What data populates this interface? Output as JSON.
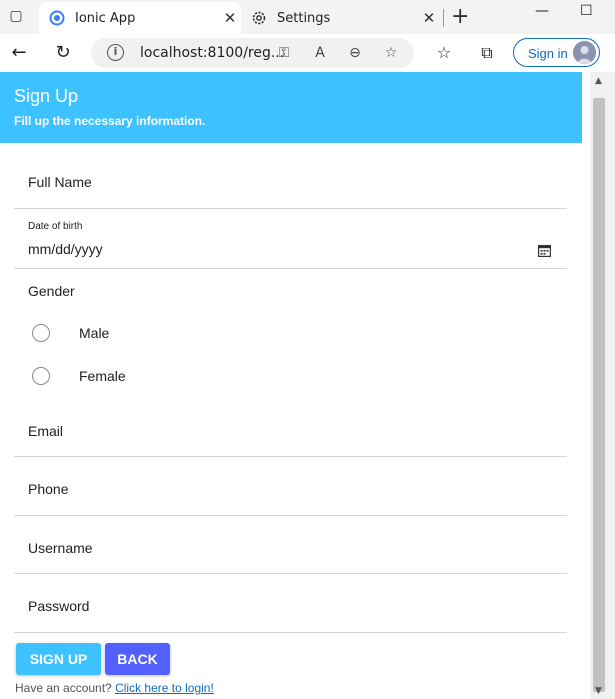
{
  "browser": {
    "tabs": [
      {
        "title": "Ionic App",
        "icon": "ionic-icon",
        "active": true
      },
      {
        "title": "Settings",
        "icon": "gear-icon",
        "active": false
      }
    ],
    "url": "localhost:8100/reg...",
    "signin_label": "Sign in",
    "accent_color": "#0f6cbd"
  },
  "page": {
    "header": {
      "title": "Sign Up",
      "subtitle": "Fill up the necessary information.",
      "color": "#3dc2ff"
    },
    "form": {
      "full_name_label": "Full Name",
      "dob_label": "Date of birth",
      "dob_value": "mm/dd/yyyy",
      "gender_label": "Gender",
      "gender_options": [
        "Male",
        "Female"
      ],
      "email_label": "Email",
      "phone_label": "Phone",
      "username_label": "Username",
      "password_label": "Password"
    },
    "buttons": {
      "signup": "SIGN UP",
      "back": "BACK",
      "signup_color": "#3dc2ff",
      "back_color": "#5260ff"
    },
    "footer": {
      "prompt": "Have an account?",
      "link": "Click here to login!"
    }
  }
}
